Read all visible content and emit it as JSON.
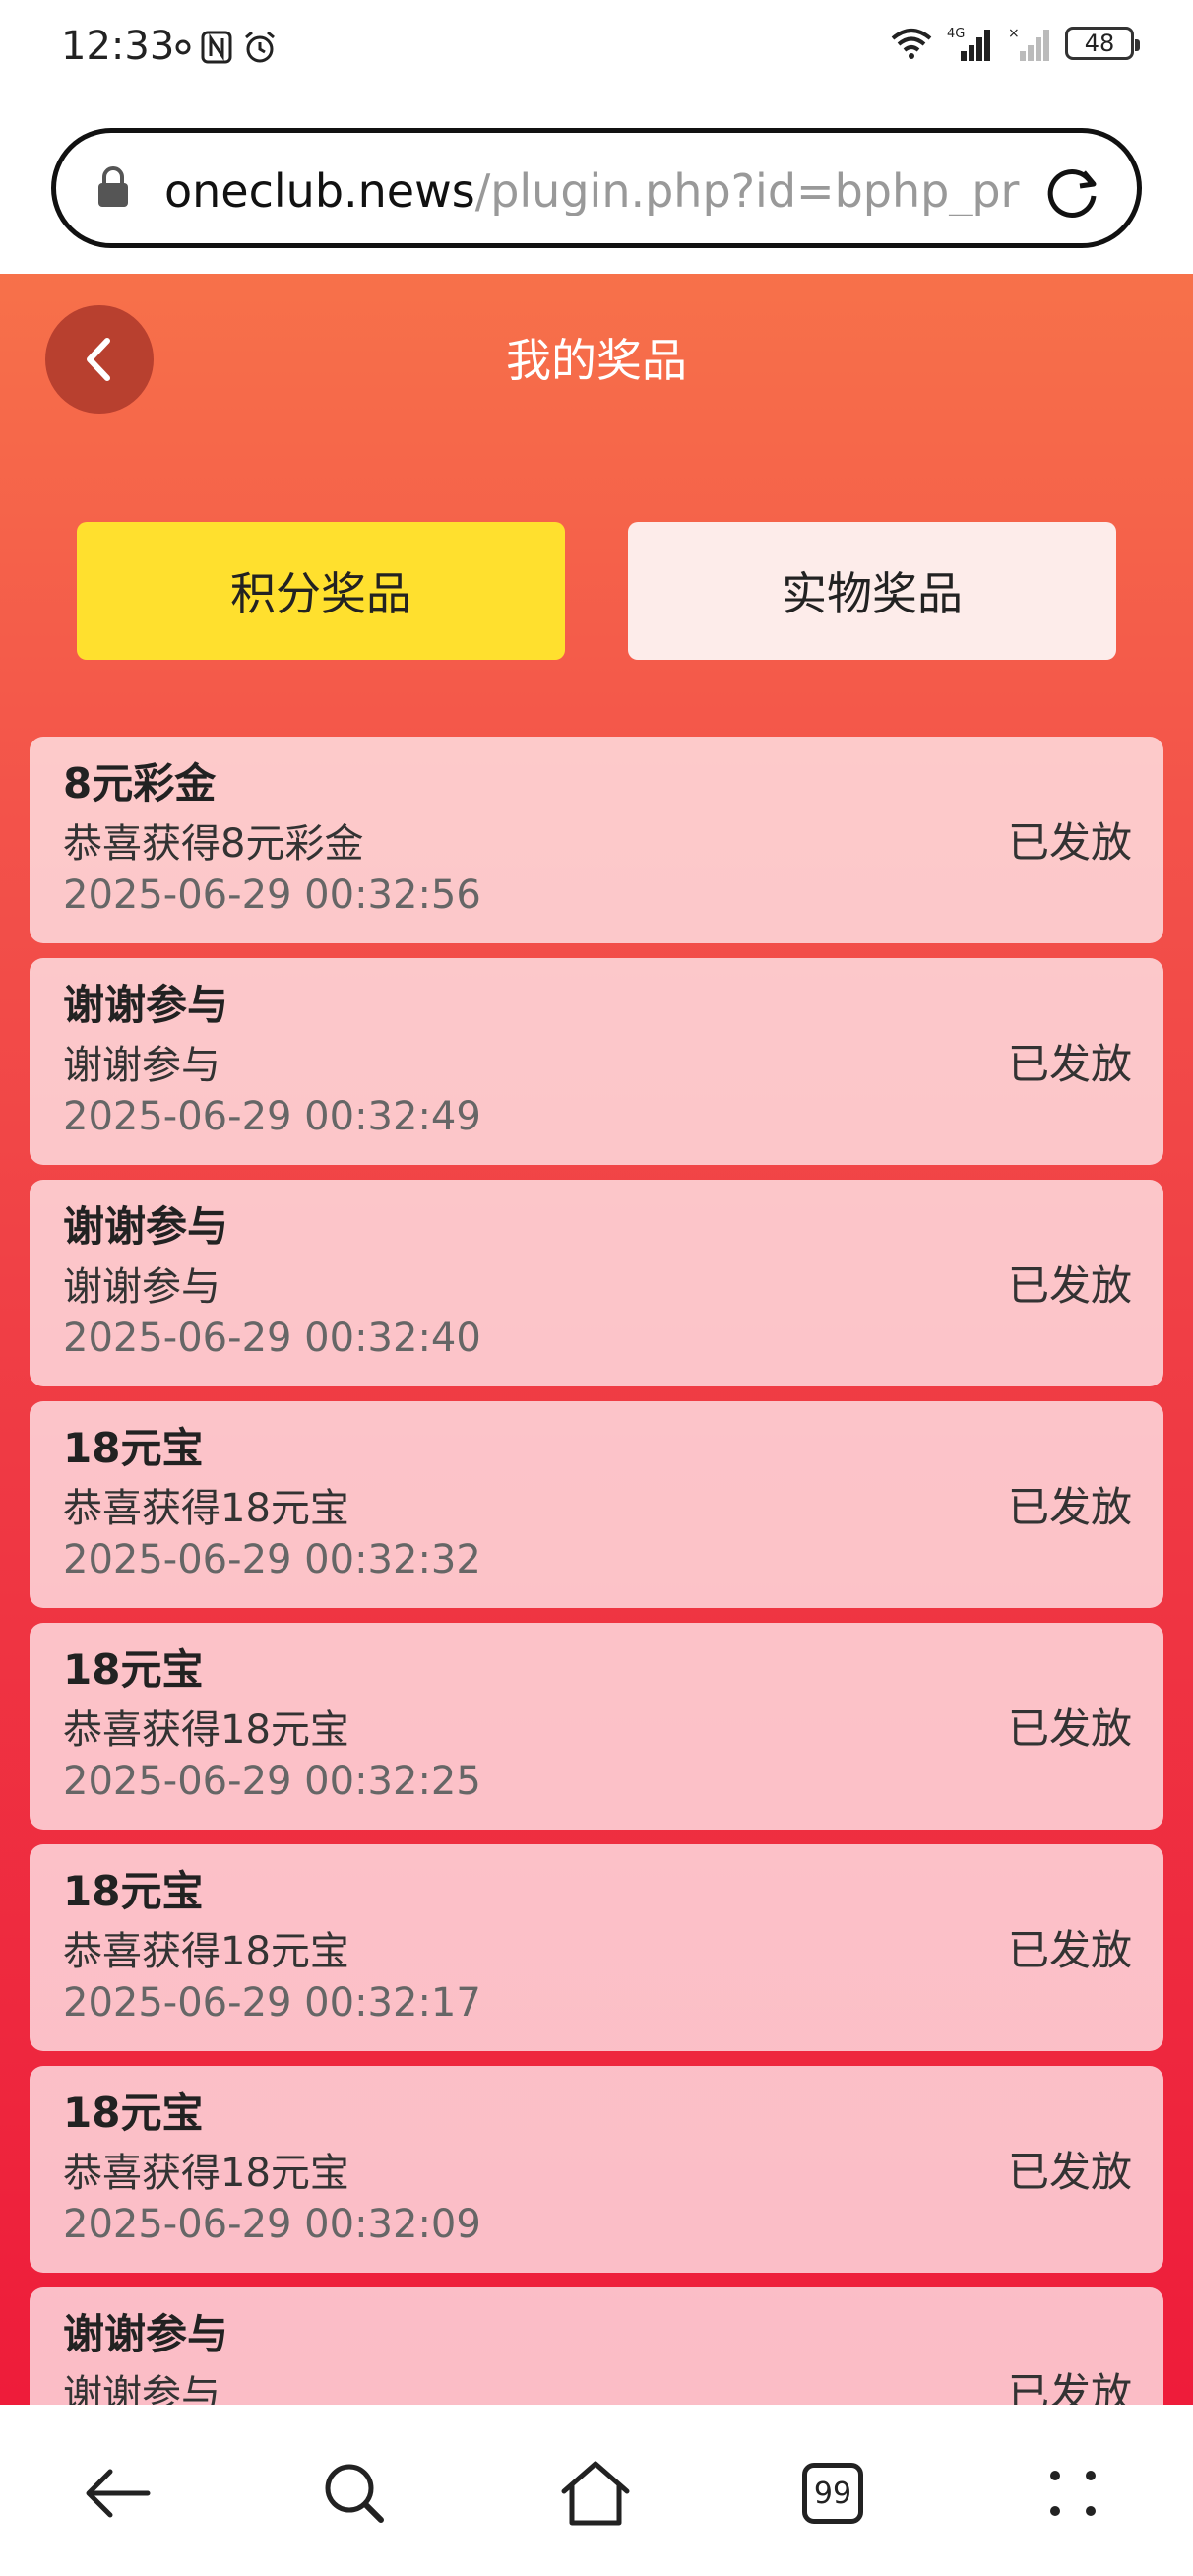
{
  "status_bar": {
    "time": "12:33",
    "battery": "48"
  },
  "url_bar": {
    "host": "oneclub.news",
    "path": "/plugin.php?id=bphp_pr"
  },
  "page": {
    "title": "我的奖品",
    "tabs": [
      {
        "label": "积分奖品",
        "active": true
      },
      {
        "label": "实物奖品",
        "active": false
      }
    ],
    "prizes": [
      {
        "title": "8元彩金",
        "desc": "恭喜获得8元彩金",
        "time": "2025-06-29 00:32:56",
        "status": "已发放"
      },
      {
        "title": "谢谢参与",
        "desc": "谢谢参与",
        "time": "2025-06-29 00:32:49",
        "status": "已发放"
      },
      {
        "title": "谢谢参与",
        "desc": "谢谢参与",
        "time": "2025-06-29 00:32:40",
        "status": "已发放"
      },
      {
        "title": "18元宝",
        "desc": "恭喜获得18元宝",
        "time": "2025-06-29 00:32:32",
        "status": "已发放"
      },
      {
        "title": "18元宝",
        "desc": "恭喜获得18元宝",
        "time": "2025-06-29 00:32:25",
        "status": "已发放"
      },
      {
        "title": "18元宝",
        "desc": "恭喜获得18元宝",
        "time": "2025-06-29 00:32:17",
        "status": "已发放"
      },
      {
        "title": "18元宝",
        "desc": "恭喜获得18元宝",
        "time": "2025-06-29 00:32:09",
        "status": "已发放"
      },
      {
        "title": "谢谢参与",
        "desc": "谢谢参与",
        "time": "",
        "status": "已发放"
      }
    ]
  },
  "bottom_nav": {
    "tab_count": "99"
  },
  "colors": {
    "accent_yellow": "#ffe02e",
    "page_red": "#ef3a44"
  }
}
